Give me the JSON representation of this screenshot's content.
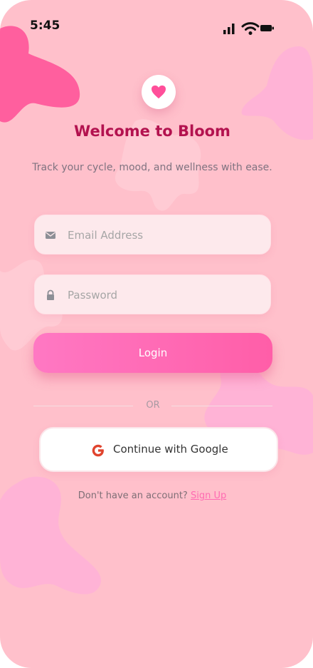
{
  "status_bar": {
    "time": "5:45",
    "icons": [
      "signal-icon",
      "wifi-icon",
      "battery-icon"
    ]
  },
  "app": {
    "logo_icon": "heart-icon",
    "title": "Welcome to Bloom",
    "subtitle": "Track your cycle, mood, and wellness with ease."
  },
  "form": {
    "email": {
      "placeholder": "Email Address",
      "value": "",
      "icon": "envelope-icon"
    },
    "password": {
      "placeholder": "Password",
      "value": "",
      "icon": "lock-icon"
    },
    "login_label": "Login",
    "divider_label": "OR",
    "google_label": "Continue with Google",
    "google_icon": "google-g-icon"
  },
  "signup": {
    "prompt": "Don't have an account?",
    "link_label": "Sign Up"
  },
  "colors": {
    "background": "#ffc0cb",
    "title": "#b3124f",
    "accent": "#ff5ea8",
    "link": "#ff6bb2"
  }
}
